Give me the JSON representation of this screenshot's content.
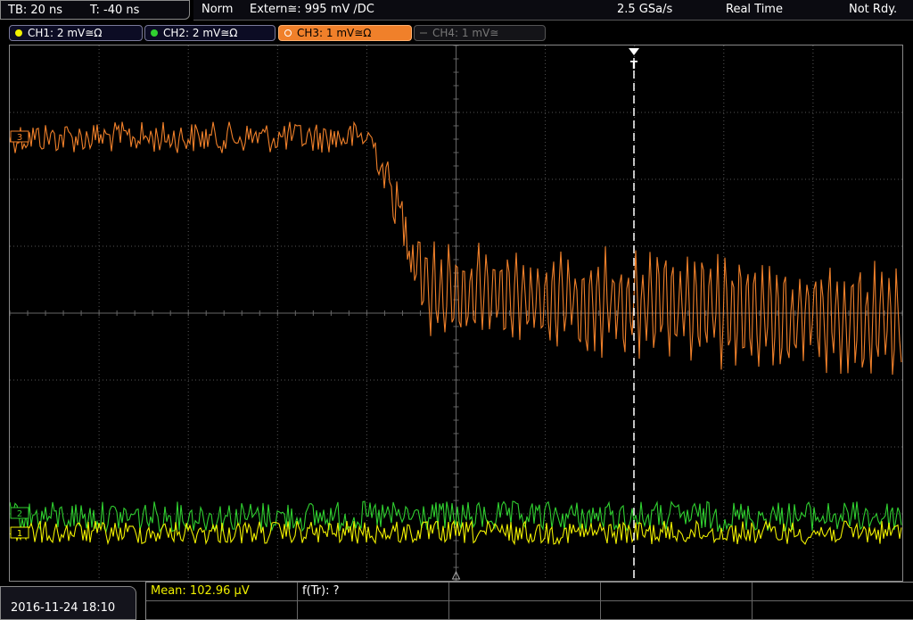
{
  "timebase": {
    "tb_label": "TB: 20 ns",
    "t_label": "T: -40 ns"
  },
  "status": {
    "mode": "Norm",
    "trigger": "Extern≅: 995 mV ∕DC",
    "sample_rate": "2.5 GSa/s",
    "acq": "Real Time",
    "state": "Not Rdy."
  },
  "channels": [
    {
      "label": "CH1: 2 mV≅Ω",
      "color": "#f0f000",
      "state": "on"
    },
    {
      "label": "CH2: 2 mV≅Ω",
      "color": "#30d030",
      "state": "on"
    },
    {
      "label": "CH3: 1 mV≅Ω",
      "color": "#f0802a",
      "state": "selected"
    },
    {
      "label": "CH4: 1 mV≅",
      "color": "#606060",
      "state": "off"
    }
  ],
  "markers": {
    "ch3": "3",
    "ch2": "2",
    "ch1": "1",
    "trigger": "T"
  },
  "bottom": {
    "datetime": "2016-11-24 18:10",
    "mean_label": "Mean: 102.96 µV",
    "ftr_label": "f(Tr): ?"
  },
  "colors": {
    "ch1": "#f0f000",
    "ch2": "#30d030",
    "ch3": "#f0802a",
    "grid": "#555555",
    "cursor": "#ffffff"
  }
}
